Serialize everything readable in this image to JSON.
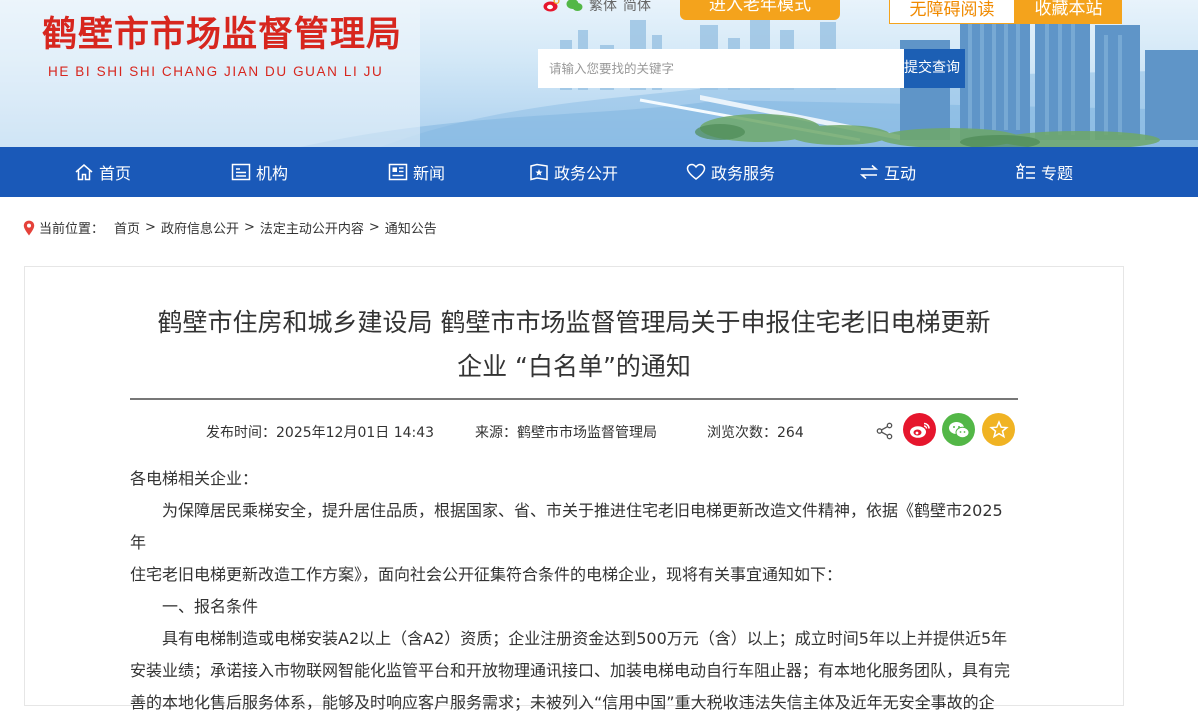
{
  "header": {
    "site_name_cn": "鹤壁市市场监督管理局",
    "site_name_pinyin": "HE BI SHI SHI CHANG JIAN DU GUAN LI JU",
    "lang_traditional": "繁体",
    "lang_simplified": "简体",
    "elder_mode_label": "进入老年模式",
    "accessibility_label": "无障碍阅读",
    "favorite_label": "收藏本站",
    "search_placeholder": "请输入您要找的关键字",
    "search_button_label": "提交查询"
  },
  "nav": {
    "items": [
      {
        "label": "首页",
        "icon": "home-icon"
      },
      {
        "label": "机构",
        "icon": "org-icon"
      },
      {
        "label": "新闻",
        "icon": "news-icon"
      },
      {
        "label": "政务公开",
        "icon": "gov-open-icon"
      },
      {
        "label": "政务服务",
        "icon": "heart-icon"
      },
      {
        "label": "互动",
        "icon": "exchange-icon"
      },
      {
        "label": "专题",
        "icon": "topic-icon"
      }
    ]
  },
  "breadcrumb": {
    "label": "当前位置：",
    "items": [
      "首页",
      "政府信息公开",
      "法定主动公开内容",
      "通知公告"
    ],
    "separator": ">"
  },
  "article": {
    "title_line1": "鹤壁市住房和城乡建设局 鹤壁市市场监督管理局关于申报住宅老旧电梯更新",
    "title_line2": "企业 “白名单”的通知",
    "publish_label": "发布时间：",
    "publish_time": "2025年12月01日 14:43",
    "source_label": "来源：",
    "source": "鹤壁市市场监督管理局",
    "views_label": "浏览次数：",
    "views": "264",
    "greeting": "各电梯相关企业：",
    "para1_line1": "为保障居民乘梯安全，提升居住品质，根据国家、省、市关于推进住宅老旧电梯更新改造文件精神，依据《鹤壁市2025年",
    "para1_line2": "住宅老旧电梯更新改造工作方案》，面向社会公开征集符合条件的电梯企业，现将有关事宜通知如下：",
    "section1": "一、报名条件",
    "para2_line1": "具有电梯制造或电梯安装A2以上（含A2）资质；企业注册资金达到500万元（含）以上；成立时间5年以上并提供近5年",
    "para2_line2": "安装业绩；承诺接入市物联网智能化监管平台和开放物理通讯接口、加装电梯电动自行车阻止器；有本地化服务团队，具有完",
    "para2_line3": "善的本地化售后服务体系，能够及时响应客户服务需求；未被列入“信用中国”重大税收违法失信主体及近年无安全事故的企"
  },
  "colors": {
    "brand_red": "#d7261e",
    "nav_blue": "#1a59b8",
    "accent_orange": "#f4a31c",
    "weibo_red": "#e6162d",
    "wechat_green": "#53b747",
    "favorite_yellow": "#f0b323"
  }
}
